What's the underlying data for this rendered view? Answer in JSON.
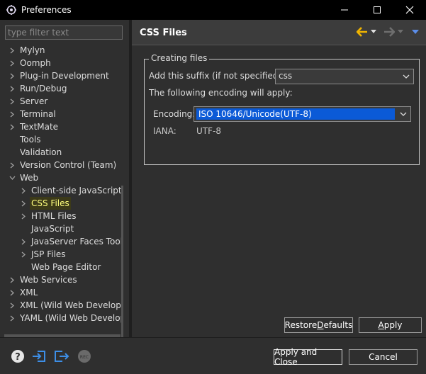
{
  "window": {
    "title": "Preferences",
    "controls": {
      "minimize": "—",
      "maximize": "☐",
      "close": "✕"
    }
  },
  "filter": {
    "placeholder": "type filter text",
    "value": ""
  },
  "tree": [
    {
      "label": "Mylyn",
      "expandable": true,
      "expanded": false,
      "level": 0
    },
    {
      "label": "Oomph",
      "expandable": true,
      "expanded": false,
      "level": 0
    },
    {
      "label": "Plug-in Development",
      "expandable": true,
      "expanded": false,
      "level": 0
    },
    {
      "label": "Run/Debug",
      "expandable": true,
      "expanded": false,
      "level": 0
    },
    {
      "label": "Server",
      "expandable": true,
      "expanded": false,
      "level": 0
    },
    {
      "label": "Terminal",
      "expandable": true,
      "expanded": false,
      "level": 0
    },
    {
      "label": "TextMate",
      "expandable": true,
      "expanded": false,
      "level": 0
    },
    {
      "label": "Tools",
      "expandable": false,
      "level": 0
    },
    {
      "label": "Validation",
      "expandable": false,
      "level": 0
    },
    {
      "label": "Version Control (Team)",
      "expandable": true,
      "expanded": false,
      "level": 0
    },
    {
      "label": "Web",
      "expandable": true,
      "expanded": true,
      "level": 0
    },
    {
      "label": "Client-side JavaScript",
      "expandable": true,
      "expanded": false,
      "level": 1
    },
    {
      "label": "CSS Files",
      "expandable": true,
      "expanded": false,
      "level": 1,
      "selected": true
    },
    {
      "label": "HTML Files",
      "expandable": true,
      "expanded": false,
      "level": 1
    },
    {
      "label": "JavaScript",
      "expandable": false,
      "level": 1
    },
    {
      "label": "JavaServer Faces Tools",
      "expandable": true,
      "expanded": false,
      "level": 1
    },
    {
      "label": "JSP Files",
      "expandable": true,
      "expanded": false,
      "level": 1
    },
    {
      "label": "Web Page Editor",
      "expandable": false,
      "level": 1
    },
    {
      "label": "Web Services",
      "expandable": true,
      "expanded": false,
      "level": 0
    },
    {
      "label": "XML",
      "expandable": true,
      "expanded": false,
      "level": 0
    },
    {
      "label": "XML (Wild Web Develope",
      "expandable": true,
      "expanded": false,
      "level": 0
    },
    {
      "label": "YAML (Wild Web Develop",
      "expandable": true,
      "expanded": false,
      "level": 0
    }
  ],
  "page": {
    "title": "CSS Files",
    "group_title": "Creating files",
    "suffix_label": "Add this suffix (if not specified):",
    "suffix_value": "css",
    "encoding_note": "The following encoding will apply:",
    "encoding_label": "Encoding:",
    "encoding_value": "ISO 10646/Unicode(UTF-8)",
    "iana_label": "IANA:",
    "iana_value": "UTF-8",
    "restore_defaults": {
      "before": "Restore ",
      "mnemonic": "D",
      "after": "efaults"
    },
    "apply": {
      "mnemonic": "A",
      "after": "pply"
    }
  },
  "footer": {
    "apply_and_close": "Apply and Close",
    "cancel": "Cancel"
  },
  "colors": {
    "accent_back_arrow": "#f0b400",
    "selection_highlight": "#ffff7e",
    "combo_selection": "#0b5ad7",
    "icon_blue": "#3d8ee6"
  }
}
